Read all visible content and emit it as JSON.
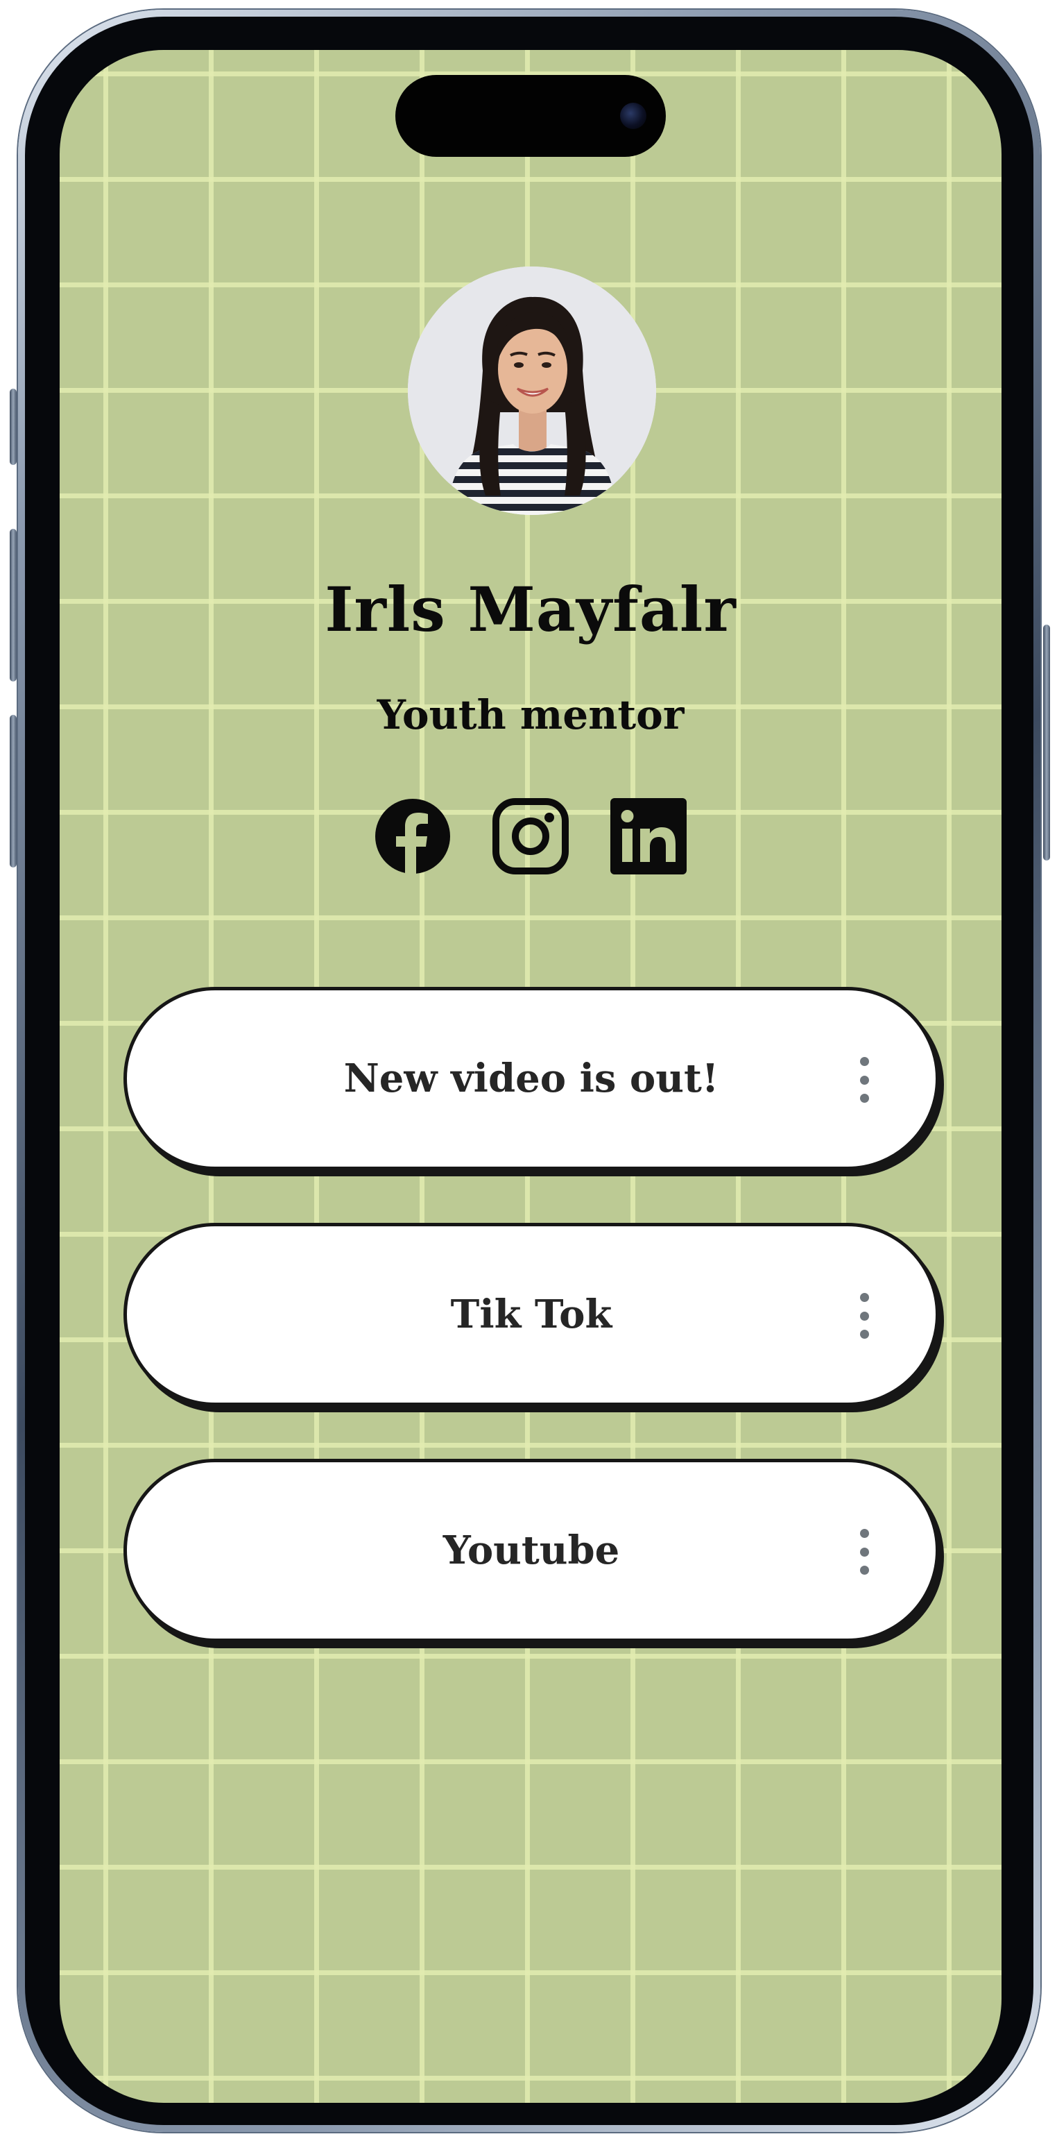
{
  "profile": {
    "name": "Irls Mayfalr",
    "role": "Youth mentor",
    "avatar_alt": "profile photo"
  },
  "socials": [
    {
      "icon": "facebook-icon"
    },
    {
      "icon": "instagram-icon"
    },
    {
      "icon": "linkedin-icon"
    }
  ],
  "links": [
    {
      "label": "New video is out!",
      "menu_icon": "more-vertical-icon"
    },
    {
      "label": "Tik Tok",
      "menu_icon": "more-vertical-icon"
    },
    {
      "label": "Youtube",
      "menu_icon": "more-vertical-icon"
    }
  ],
  "theme": {
    "background": "#bcca94",
    "grid_line": "#e2ecb0",
    "button_fill": "#ffffff",
    "button_border": "#161616",
    "text": "#0b0b0b",
    "menu_dots": "#6f767c"
  }
}
